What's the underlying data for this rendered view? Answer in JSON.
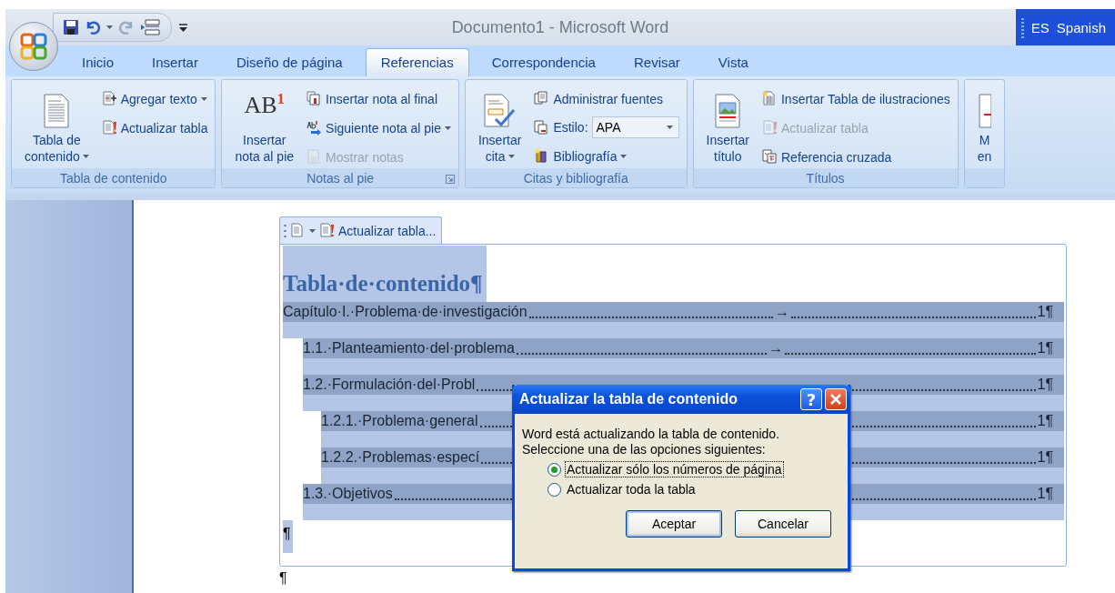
{
  "window": {
    "title": "Documento1 - Microsoft Word"
  },
  "language_bar": {
    "code": "ES",
    "label": "Spanish"
  },
  "tabs": [
    {
      "label": "Inicio",
      "selected": false
    },
    {
      "label": "Insertar",
      "selected": false
    },
    {
      "label": "Diseño de página",
      "selected": false
    },
    {
      "label": "Referencias",
      "selected": true
    },
    {
      "label": "Correspondencia",
      "selected": false
    },
    {
      "label": "Revisar",
      "selected": false
    },
    {
      "label": "Vista",
      "selected": false
    }
  ],
  "ribbon": {
    "groups": [
      {
        "label": "Tabla de contenido",
        "launcher": false,
        "columns": [
          {
            "kind": "large",
            "lines": [
              "Tabla de",
              "contenido"
            ],
            "dropdown": true
          },
          {
            "kind": "stack",
            "items": [
              {
                "kind": "button",
                "label": "Agregar texto",
                "dropdown": true,
                "disabled": false
              },
              {
                "kind": "button",
                "label": "Actualizar tabla",
                "dropdown": false,
                "disabled": false
              }
            ]
          }
        ]
      },
      {
        "label": "Notas al pie",
        "launcher": true,
        "columns": [
          {
            "kind": "large",
            "glyph": "AB$^{1}$",
            "lines": [
              "Insertar",
              "nota al pie"
            ],
            "dropdown": false
          },
          {
            "kind": "stack",
            "items": [
              {
                "kind": "button",
                "label": "Insertar nota al final",
                "dropdown": false,
                "disabled": false
              },
              {
                "kind": "button",
                "label": "Siguiente nota al pie",
                "dropdown": true,
                "disabled": false
              },
              {
                "kind": "button",
                "label": "Mostrar notas",
                "dropdown": false,
                "disabled": true
              }
            ]
          }
        ]
      },
      {
        "label": "Citas y bibliografía",
        "launcher": false,
        "columns": [
          {
            "kind": "large",
            "lines": [
              "Insertar",
              "cita"
            ],
            "dropdown": true
          },
          {
            "kind": "stack",
            "items": [
              {
                "kind": "button",
                "label": "Administrar fuentes",
                "dropdown": false,
                "disabled": false
              },
              {
                "kind": "combo",
                "label": "Estilo:",
                "value": "APA"
              },
              {
                "kind": "button",
                "label": "Bibliografía",
                "dropdown": true,
                "disabled": false
              }
            ]
          }
        ]
      },
      {
        "label": "Títulos",
        "launcher": false,
        "columns": [
          {
            "kind": "large",
            "lines": [
              "Insertar",
              "título"
            ],
            "dropdown": false
          },
          {
            "kind": "stack",
            "items": [
              {
                "kind": "button",
                "label": "Insertar Tabla de ilustraciones",
                "dropdown": false,
                "disabled": false
              },
              {
                "kind": "button",
                "label": "Actualizar tabla",
                "dropdown": false,
                "disabled": true
              },
              {
                "kind": "button",
                "label": "Referencia cruzada",
                "dropdown": false,
                "disabled": false
              }
            ]
          }
        ]
      },
      {
        "launcher": false,
        "columns": [
          {
            "kind": "large",
            "lines": [
              "M",
              "en"
            ],
            "dropdown": false
          }
        ]
      }
    ]
  },
  "document": {
    "toc_control": {
      "tab_label": "Actualizar tabla...",
      "heading": "Tabla·de·contenido¶",
      "entries": [
        {
          "title": "Capítulo·I.·Problema·de·investigación",
          "tab_mark": "→",
          "page": "1¶",
          "children": [
            {
              "title": "1.1.·Planteamiento·del·problema",
              "tab_mark": "→",
              "page": "1¶"
            },
            {
              "title": "1.2.·Formulación·del·Probl",
              "page": "1¶",
              "children": [
                {
                  "title": "1.2.1.·Problema·general",
                  "page": "1¶"
                },
                {
                  "title": "1.2.2.·Problemas·especí",
                  "page": "1¶"
                }
              ]
            },
            {
              "title": "1.3.·Objetivos",
              "page": "1¶"
            }
          ]
        }
      ],
      "end_mark": "¶"
    },
    "after_mark": "¶"
  },
  "dialog": {
    "title": "Actualizar la tabla de contenido",
    "help": "?",
    "message": [
      "Word está actualizando la tabla de contenido.",
      "Seleccione una de las opciones siguientes:"
    ],
    "options": [
      {
        "label": "Actualizar sólo los números de página",
        "selected": true,
        "focused": true
      },
      {
        "label": "Actualizar toda la tabla",
        "selected": false,
        "focused": false
      }
    ],
    "buttons": [
      {
        "label": "Aceptar",
        "default": true
      },
      {
        "label": "Cancelar",
        "default": false
      }
    ]
  }
}
